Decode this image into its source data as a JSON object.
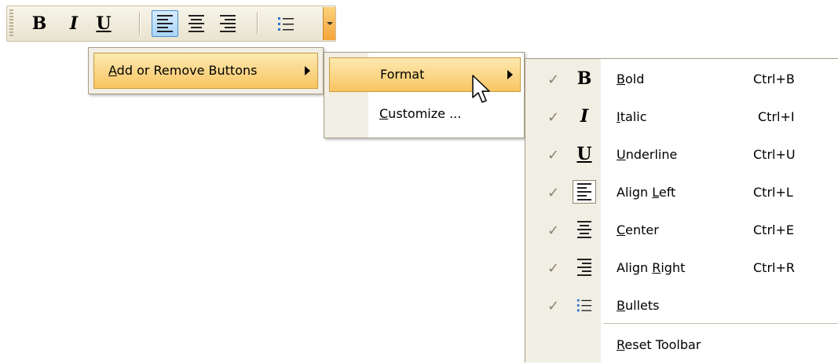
{
  "toolbar": {
    "buttons": [
      {
        "name": "bold",
        "glyph": "B"
      },
      {
        "name": "italic",
        "glyph": "I"
      },
      {
        "name": "underline",
        "glyph": "U"
      },
      {
        "name": "align-left",
        "active": true
      },
      {
        "name": "center"
      },
      {
        "name": "align-right"
      },
      {
        "name": "bullets"
      }
    ]
  },
  "menu1": {
    "label_pre": "",
    "label_accel": "A",
    "label_rest": "dd or Remove Buttons"
  },
  "menu2": {
    "format_label": "Format",
    "customize_accel": "C",
    "customize_rest": "ustomize ..."
  },
  "menu3": {
    "items": [
      {
        "pre": "",
        "accel": "B",
        "post": "old",
        "shortcut": "Ctrl+B"
      },
      {
        "pre": "",
        "accel": "I",
        "post": "talic",
        "shortcut": "Ctrl+I"
      },
      {
        "pre": "",
        "accel": "U",
        "post": "nderline",
        "shortcut": "Ctrl+U"
      },
      {
        "pre": "Align ",
        "accel": "L",
        "post": "eft",
        "shortcut": "Ctrl+L"
      },
      {
        "pre": "",
        "accel": "C",
        "post": "enter",
        "shortcut": "Ctrl+E"
      },
      {
        "pre": "Align ",
        "accel": "R",
        "post": "ight",
        "shortcut": "Ctrl+R"
      },
      {
        "pre": "",
        "accel": "B",
        "post": "ullets",
        "shortcut": ""
      }
    ],
    "reset_accel": "R",
    "reset_rest": "eset Toolbar",
    "check_glyph": "✓"
  },
  "colors": {
    "highlight_top": "#fde9b1",
    "highlight_bottom": "#f8c562",
    "gutter": "#f1eee4",
    "active_button": "#a9d4fb"
  }
}
